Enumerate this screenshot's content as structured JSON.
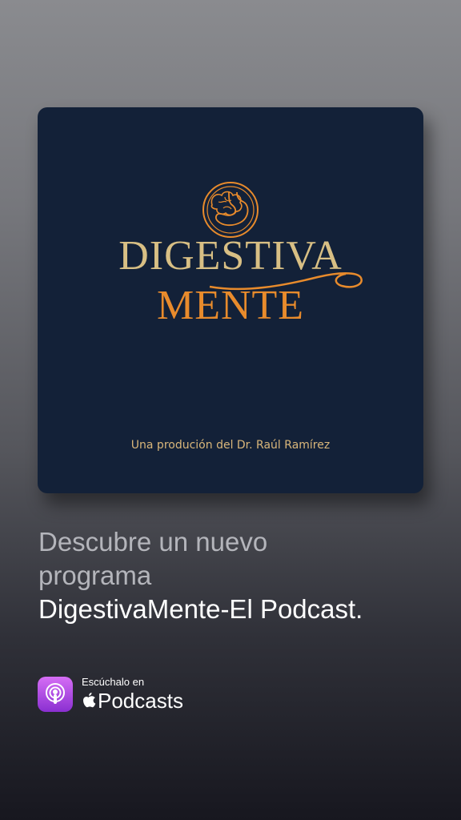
{
  "cover": {
    "title_top": "DIGESTIVA",
    "title_bottom": "MENTE",
    "credit": "Una produción del Dr. Raúl Ramírez",
    "colors": {
      "background": "#132138",
      "gold": "#d8bf84",
      "orange": "#e88b2c"
    }
  },
  "headline": {
    "line1": "Descubre un nuevo",
    "line2": "programa",
    "line3": "DigestivaMente-El Podcast."
  },
  "badge": {
    "small_label": "Escúchalo en",
    "big_label": "Podcasts",
    "icon": "apple-podcasts-icon",
    "brand_icon": "apple-logo-icon"
  }
}
